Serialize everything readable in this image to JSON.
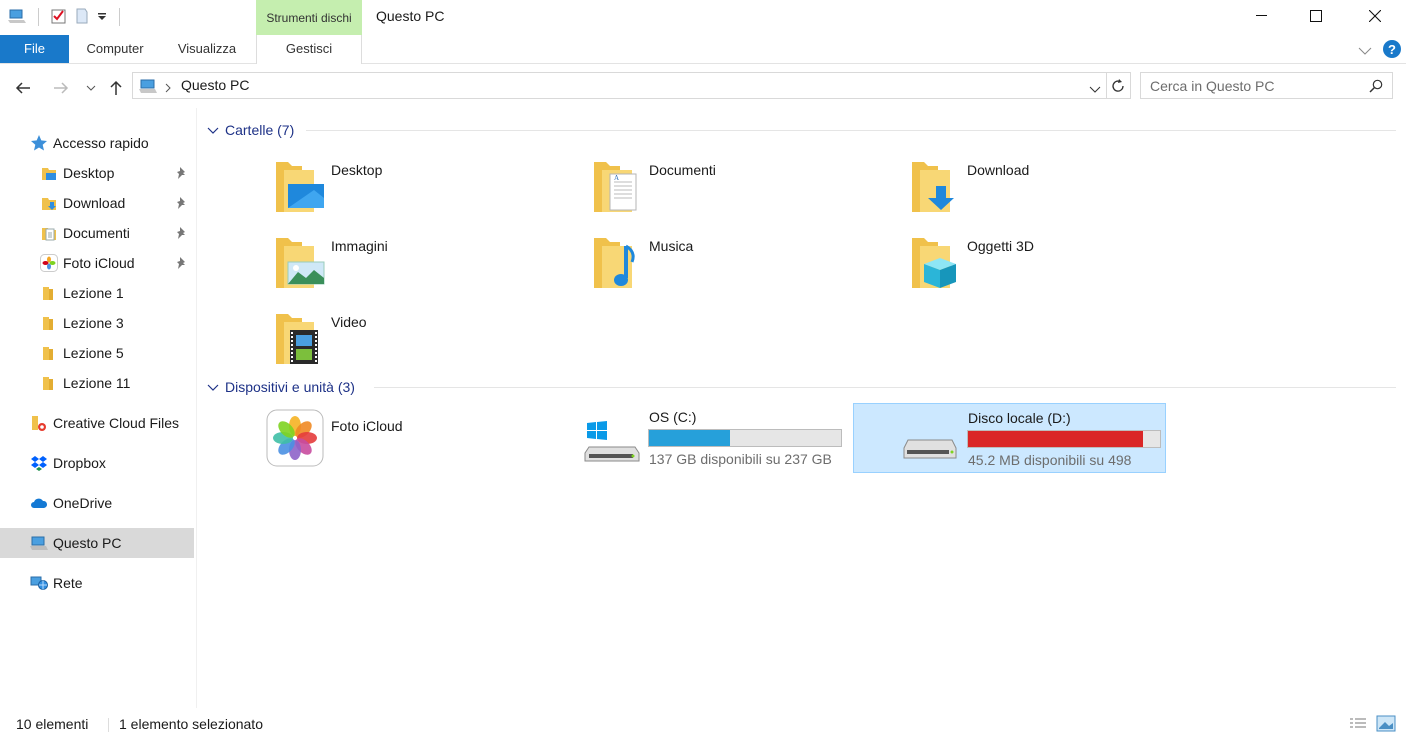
{
  "window": {
    "title": "Questo PC",
    "context_tab": "Strumenti dischi"
  },
  "ribbon": {
    "tabs": [
      "File",
      "Computer",
      "Visualizza",
      "Gestisci"
    ]
  },
  "address": {
    "path": "Questo PC",
    "search_placeholder": "Cerca in Questo PC"
  },
  "nav": {
    "quick_access": "Accesso rapido",
    "items": [
      {
        "label": "Desktop",
        "pinned": true
      },
      {
        "label": "Download",
        "pinned": true
      },
      {
        "label": "Documenti",
        "pinned": true
      },
      {
        "label": "Foto iCloud",
        "pinned": true
      },
      {
        "label": "Lezione 1",
        "pinned": false
      },
      {
        "label": "Lezione 3",
        "pinned": false
      },
      {
        "label": "Lezione 5",
        "pinned": false
      },
      {
        "label": "Lezione 11",
        "pinned": false
      }
    ],
    "creative_cloud": "Creative Cloud Files",
    "dropbox": "Dropbox",
    "onedrive": "OneDrive",
    "this_pc": "Questo PC",
    "network": "Rete"
  },
  "content": {
    "folders_header": "Cartelle (7)",
    "folders": [
      {
        "label": "Desktop",
        "icon": "desktop-folder-icon"
      },
      {
        "label": "Documenti",
        "icon": "documents-folder-icon"
      },
      {
        "label": "Download",
        "icon": "downloads-folder-icon"
      },
      {
        "label": "Immagini",
        "icon": "pictures-folder-icon"
      },
      {
        "label": "Musica",
        "icon": "music-folder-icon"
      },
      {
        "label": "Oggetti 3D",
        "icon": "3d-objects-folder-icon"
      },
      {
        "label": "Video",
        "icon": "videos-folder-icon"
      }
    ],
    "devices_header": "Dispositivi e unità (3)",
    "icloud_label": "Foto iCloud",
    "drives": [
      {
        "name": "OS (C:)",
        "free_text": "137 GB disponibili su 237 GB",
        "used_fraction": 0.42,
        "color": "#26a0da"
      },
      {
        "name": "Disco locale (D:)",
        "free_text": "45.2 MB disponibili su 498",
        "used_fraction": 0.91,
        "color": "#da2626"
      }
    ]
  },
  "status": {
    "count": "10 elementi",
    "selected": "1 elemento selezionato"
  },
  "colors": {
    "accent": "#1979ca",
    "context_tab": "#c5eeaf",
    "selection": "#cce8ff",
    "group_header": "#1e3287"
  }
}
